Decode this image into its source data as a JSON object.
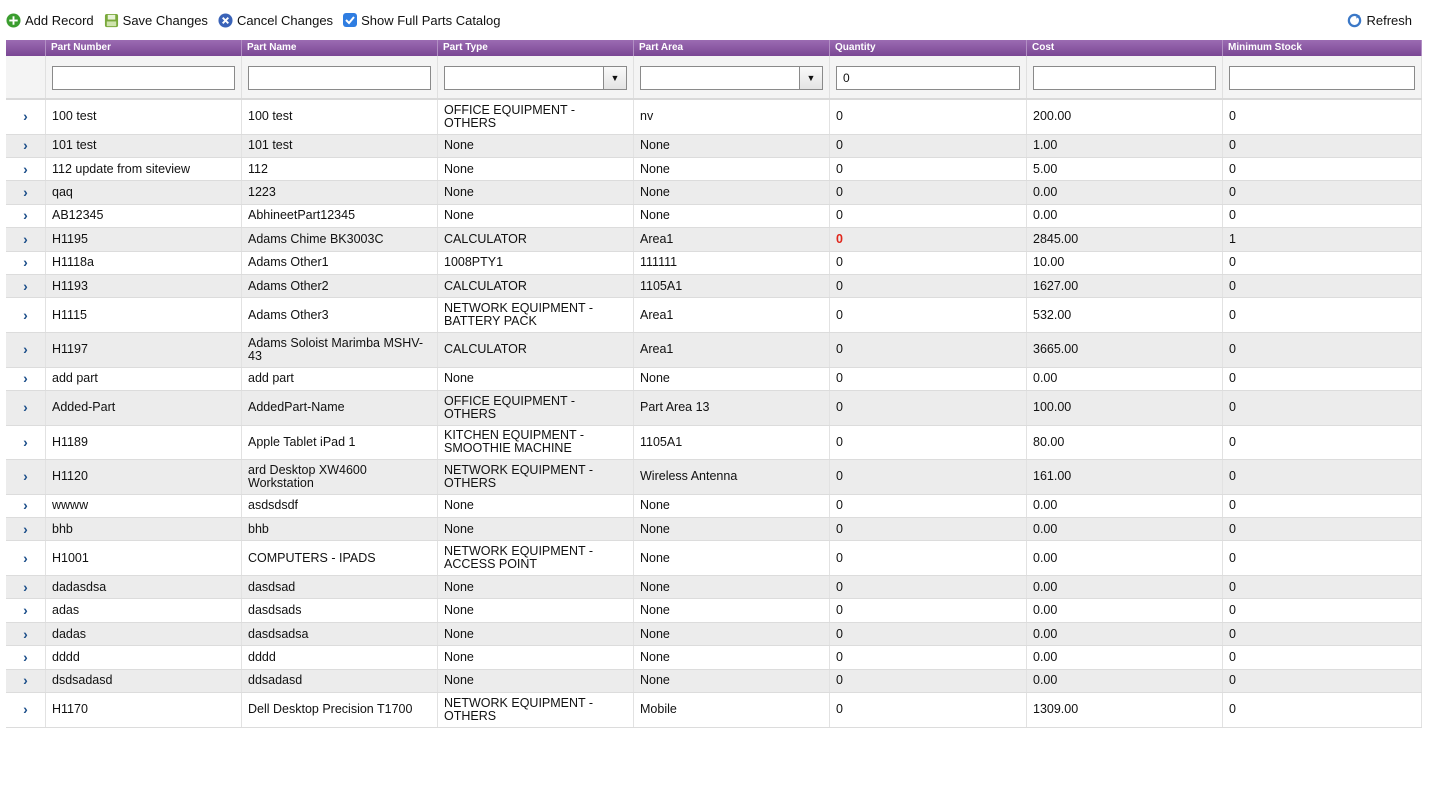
{
  "toolbar": {
    "add_label": "Add Record",
    "save_label": "Save Changes",
    "cancel_label": "Cancel Changes",
    "catalog_label": "Show Full Parts Catalog",
    "catalog_checked": true,
    "refresh_label": "Refresh"
  },
  "columns": [
    "Part Number",
    "Part Name",
    "Part Type",
    "Part Area",
    "Quantity",
    "Cost",
    "Minimum Stock"
  ],
  "filters": {
    "quantity_value": "0"
  },
  "colors": {
    "header": "#8a58a3",
    "expand_arrow": "#1c4f8a",
    "alert_red": "#e0261b"
  },
  "rows": [
    {
      "part_number": "100 test",
      "part_name": "100 test",
      "part_type": "OFFICE EQUIPMENT - OTHERS",
      "part_area": "nv",
      "quantity": "0",
      "cost": "200.00",
      "min_stock": "0",
      "tall": true
    },
    {
      "part_number": "101 test",
      "part_name": "101 test",
      "part_type": "None",
      "part_area": "None",
      "quantity": "0",
      "cost": "1.00",
      "min_stock": "0"
    },
    {
      "part_number": "112 update from siteview",
      "part_name": "112",
      "part_type": "None",
      "part_area": "None",
      "quantity": "0",
      "cost": "5.00",
      "min_stock": "0"
    },
    {
      "part_number": "qaq",
      "part_name": "1223",
      "part_type": "None",
      "part_area": "None",
      "quantity": "0",
      "cost": "0.00",
      "min_stock": "0"
    },
    {
      "part_number": "AB12345",
      "part_name": "AbhineetPart12345",
      "part_type": "None",
      "part_area": "None",
      "quantity": "0",
      "cost": "0.00",
      "min_stock": "0"
    },
    {
      "part_number": "H1195",
      "part_name": "Adams Chime BK3003C",
      "part_type": "CALCULATOR",
      "part_area": "Area1",
      "quantity": "0",
      "cost": "2845.00",
      "min_stock": "1",
      "alert": true
    },
    {
      "part_number": "H1118a",
      "part_name": "Adams Other1",
      "part_type": "1008PTY1",
      "part_area": "111111",
      "quantity": "0",
      "cost": "10.00",
      "min_stock": "0"
    },
    {
      "part_number": "H1193",
      "part_name": "Adams Other2",
      "part_type": "CALCULATOR",
      "part_area": "1105A1",
      "quantity": "0",
      "cost": "1627.00",
      "min_stock": "0"
    },
    {
      "part_number": "H1115",
      "part_name": "Adams Other3",
      "part_type": "NETWORK EQUIPMENT - BATTERY PACK",
      "part_area": "Area1",
      "quantity": "0",
      "cost": "532.00",
      "min_stock": "0",
      "tall": true
    },
    {
      "part_number": "H1197",
      "part_name": "Adams Soloist Marimba MSHV-43",
      "part_type": "CALCULATOR",
      "part_area": "Area1",
      "quantity": "0",
      "cost": "3665.00",
      "min_stock": "0",
      "tall": true
    },
    {
      "part_number": "add part",
      "part_name": "add part",
      "part_type": "None",
      "part_area": "None",
      "quantity": "0",
      "cost": "0.00",
      "min_stock": "0"
    },
    {
      "part_number": "Added-Part",
      "part_name": "AddedPart-Name",
      "part_type": "OFFICE EQUIPMENT - OTHERS",
      "part_area": "Part Area 13",
      "quantity": "0",
      "cost": "100.00",
      "min_stock": "0",
      "tall": true
    },
    {
      "part_number": "H1189",
      "part_name": "Apple Tablet iPad 1",
      "part_type": "KITCHEN EQUIPMENT - SMOOTHIE MACHINE",
      "part_area": "1105A1",
      "quantity": "0",
      "cost": "80.00",
      "min_stock": "0",
      "tall": true
    },
    {
      "part_number": "H1120",
      "part_name": "ard Desktop XW4600 Workstation",
      "part_type": "NETWORK EQUIPMENT - OTHERS",
      "part_area": "Wireless Antenna",
      "quantity": "0",
      "cost": "161.00",
      "min_stock": "0",
      "tall": true
    },
    {
      "part_number": "wwww",
      "part_name": "asdsdsdf",
      "part_type": "None",
      "part_area": "None",
      "quantity": "0",
      "cost": "0.00",
      "min_stock": "0"
    },
    {
      "part_number": "bhb",
      "part_name": "bhb",
      "part_type": "None",
      "part_area": "None",
      "quantity": "0",
      "cost": "0.00",
      "min_stock": "0"
    },
    {
      "part_number": "H1001",
      "part_name": "COMPUTERS - IPADS",
      "part_type": "NETWORK EQUIPMENT - ACCESS POINT",
      "part_area": "None",
      "quantity": "0",
      "cost": "0.00",
      "min_stock": "0",
      "tall": true
    },
    {
      "part_number": "dadasdsa",
      "part_name": "dasdsad",
      "part_type": "None",
      "part_area": "None",
      "quantity": "0",
      "cost": "0.00",
      "min_stock": "0"
    },
    {
      "part_number": "adas",
      "part_name": "dasdsads",
      "part_type": "None",
      "part_area": "None",
      "quantity": "0",
      "cost": "0.00",
      "min_stock": "0"
    },
    {
      "part_number": "dadas",
      "part_name": "dasdsadsa",
      "part_type": "None",
      "part_area": "None",
      "quantity": "0",
      "cost": "0.00",
      "min_stock": "0"
    },
    {
      "part_number": "dddd",
      "part_name": "dddd",
      "part_type": "None",
      "part_area": "None",
      "quantity": "0",
      "cost": "0.00",
      "min_stock": "0"
    },
    {
      "part_number": "dsdsadasd",
      "part_name": "ddsadasd",
      "part_type": "None",
      "part_area": "None",
      "quantity": "0",
      "cost": "0.00",
      "min_stock": "0"
    },
    {
      "part_number": "H1170",
      "part_name": "Dell Desktop Precision T1700",
      "part_type": "NETWORK EQUIPMENT - OTHERS",
      "part_area": "Mobile",
      "quantity": "0",
      "cost": "1309.00",
      "min_stock": "0",
      "tall": true
    }
  ]
}
